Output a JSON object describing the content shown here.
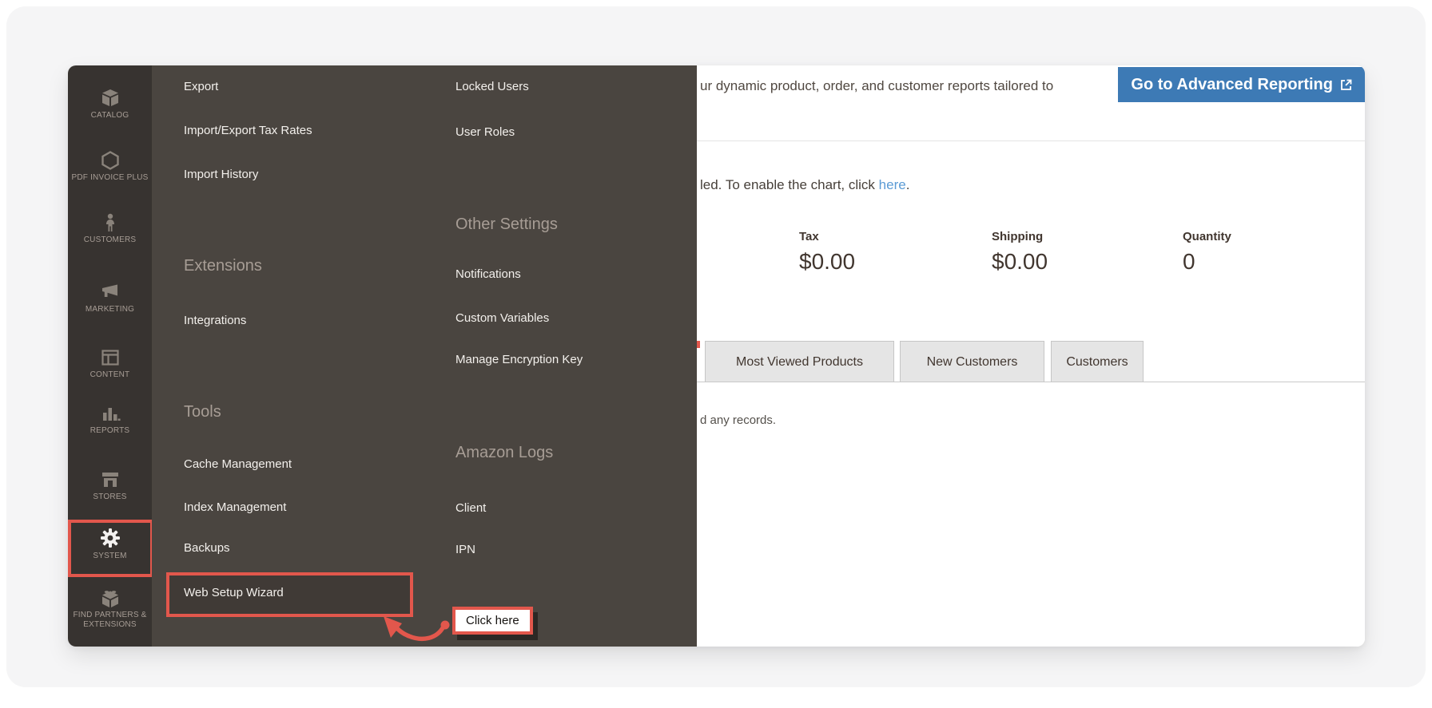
{
  "colors": {
    "accent_red": "#e2574c",
    "button_blue": "#3d7ab5",
    "link_blue": "#5b9bd5",
    "sidebar_bg": "#373330",
    "flyout_bg": "#4a4540"
  },
  "sidebar": {
    "items": [
      {
        "label": "CATALOG",
        "icon": "catalog-icon"
      },
      {
        "label": "PDF INVOICE PLUS",
        "icon": "pdf-invoice-plus-icon"
      },
      {
        "label": "CUSTOMERS",
        "icon": "customers-icon"
      },
      {
        "label": "MARKETING",
        "icon": "marketing-icon"
      },
      {
        "label": "CONTENT",
        "icon": "content-icon"
      },
      {
        "label": "REPORTS",
        "icon": "reports-icon"
      },
      {
        "label": "STORES",
        "icon": "stores-icon"
      },
      {
        "label": "SYSTEM",
        "icon": "system-icon",
        "highlighted": true
      },
      {
        "label": "FIND PARTNERS & EXTENSIONS",
        "icon": "find-partners-icon"
      }
    ]
  },
  "menu": {
    "column1": [
      {
        "type": "item",
        "label": "Export"
      },
      {
        "type": "item",
        "label": "Import/Export Tax Rates"
      },
      {
        "type": "item",
        "label": "Import History"
      },
      {
        "type": "heading",
        "label": "Extensions"
      },
      {
        "type": "item",
        "label": "Integrations"
      },
      {
        "type": "heading",
        "label": "Tools"
      },
      {
        "type": "item",
        "label": "Cache Management"
      },
      {
        "type": "item",
        "label": "Index Management"
      },
      {
        "type": "item",
        "label": "Backups"
      },
      {
        "type": "item",
        "label": "Web Setup Wizard",
        "highlighted": true
      }
    ],
    "column2": [
      {
        "type": "item",
        "label": "Locked Users"
      },
      {
        "type": "item",
        "label": "User Roles"
      },
      {
        "type": "heading",
        "label": "Other Settings"
      },
      {
        "type": "item",
        "label": "Notifications"
      },
      {
        "type": "item",
        "label": "Custom Variables"
      },
      {
        "type": "item",
        "label": "Manage Encryption Key"
      },
      {
        "type": "heading",
        "label": "Amazon Logs"
      },
      {
        "type": "item",
        "label": "Client"
      },
      {
        "type": "item",
        "label": "IPN"
      }
    ]
  },
  "dashboard": {
    "header_text": "ur dynamic product, order, and customer reports tailored to",
    "advanced_reporting_button": "Go to Advanced Reporting",
    "chart_notice_prefix": "led. To enable the chart, click ",
    "chart_notice_link": "here",
    "chart_notice_suffix": ".",
    "stats": [
      {
        "label": "Tax",
        "value": "$0.00"
      },
      {
        "label": "Shipping",
        "value": "$0.00"
      },
      {
        "label": "Quantity",
        "value": "0"
      }
    ],
    "tabs": [
      "Most Viewed Products",
      "New Customers",
      "Customers"
    ],
    "empty_text": "d any records."
  },
  "annotation": {
    "label": "Click here"
  }
}
